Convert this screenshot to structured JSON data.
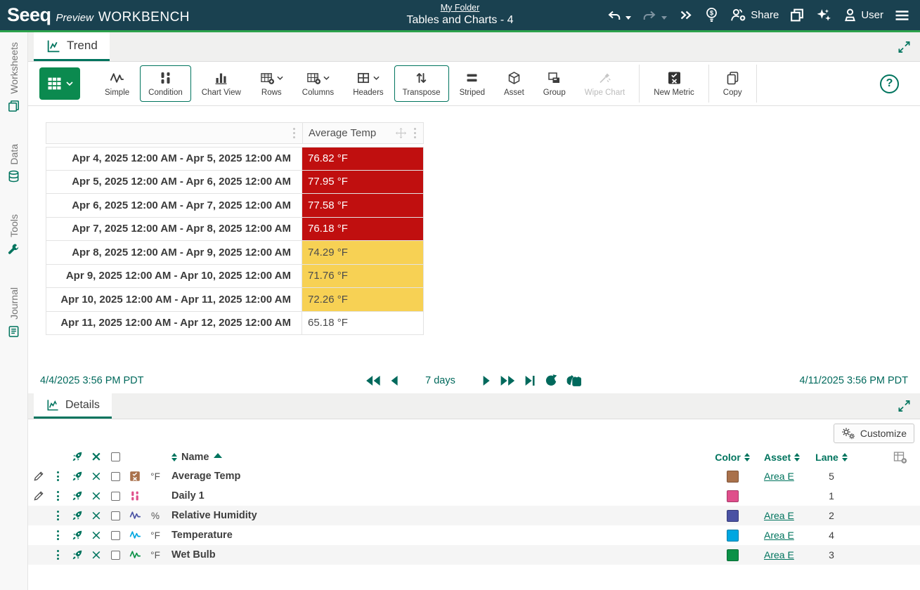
{
  "theme": {
    "accent": "#00745e",
    "topbar_bg": "#1a4150",
    "topbar_green": "#2ca24c",
    "view_button_green": "#0b8a4f",
    "alert_red": "#c00f0f",
    "warn_yellow": "#f7d154"
  },
  "topbar": {
    "brand": "Seeq",
    "preview": "Preview",
    "product": "WORKBENCH",
    "breadcrumb": "My Folder",
    "title": "Tables and Charts - 4",
    "share": "Share",
    "user": "User"
  },
  "sidebar": {
    "items": [
      {
        "label": "Worksheets"
      },
      {
        "label": "Data"
      },
      {
        "label": "Tools"
      },
      {
        "label": "Journal"
      }
    ]
  },
  "trend": {
    "tab": "Trend",
    "toolbar": {
      "simple": "Simple",
      "condition": "Condition",
      "chart_view": "Chart View",
      "rows": "Rows",
      "columns": "Columns",
      "headers": "Headers",
      "transpose": "Transpose",
      "striped": "Striped",
      "asset": "Asset",
      "group": "Group",
      "wipe_chart": "Wipe Chart",
      "new_metric": "New Metric",
      "copy": "Copy"
    },
    "table": {
      "value_column": "Average Temp",
      "rows": [
        {
          "range": "Apr 4, 2025 12:00 AM - Apr 5, 2025 12:00 AM",
          "value": "76.82 °F",
          "bg": "#c00f0f",
          "fg": "#ffffff"
        },
        {
          "range": "Apr 5, 2025 12:00 AM - Apr 6, 2025 12:00 AM",
          "value": "77.95 °F",
          "bg": "#c00f0f",
          "fg": "#ffffff"
        },
        {
          "range": "Apr 6, 2025 12:00 AM - Apr 7, 2025 12:00 AM",
          "value": "77.58 °F",
          "bg": "#c00f0f",
          "fg": "#ffffff"
        },
        {
          "range": "Apr 7, 2025 12:00 AM - Apr 8, 2025 12:00 AM",
          "value": "76.18 °F",
          "bg": "#c00f0f",
          "fg": "#ffffff"
        },
        {
          "range": "Apr 8, 2025 12:00 AM - Apr 9, 2025 12:00 AM",
          "value": "74.29 °F",
          "bg": "#f7d154",
          "fg": "#4b4b4b"
        },
        {
          "range": "Apr 9, 2025 12:00 AM - Apr 10, 2025 12:00 AM",
          "value": "71.76 °F",
          "bg": "#f7d154",
          "fg": "#4b4b4b"
        },
        {
          "range": "Apr 10, 2025 12:00 AM - Apr 11, 2025 12:00 AM",
          "value": "72.26 °F",
          "bg": "#f7d154",
          "fg": "#4b4b4b"
        },
        {
          "range": "Apr 11, 2025 12:00 AM - Apr 12, 2025 12:00 AM",
          "value": "65.18 °F",
          "bg": "#ffffff",
          "fg": "#4b4b4b"
        }
      ]
    },
    "timebar": {
      "start": "4/4/2025 3:56 PM  PDT",
      "duration": "7 days",
      "end": "4/11/2025 3:56 PM  PDT"
    }
  },
  "details": {
    "tab": "Details",
    "customize": "Customize",
    "columns": {
      "name": "Name",
      "color": "Color",
      "asset": "Asset",
      "lane": "Lane"
    },
    "rows": [
      {
        "type": "metric",
        "unit": "°F",
        "name": "Average Temp",
        "color": "#a9714b",
        "asset": "Area E",
        "lane": "5"
      },
      {
        "type": "condition",
        "unit": "",
        "name": "Daily 1",
        "color": "#df4e8b",
        "asset": "",
        "lane": "1"
      },
      {
        "type": "signal",
        "unit": "%",
        "name": "Relative Humidity",
        "color": "#4a52a3",
        "asset": "Area E",
        "lane": "2"
      },
      {
        "type": "signal",
        "unit": "°F",
        "name": "Temperature",
        "color": "#00a7e1",
        "asset": "Area E",
        "lane": "4"
      },
      {
        "type": "signal",
        "unit": "°F",
        "name": "Wet Bulb",
        "color": "#0b9147",
        "asset": "Area E",
        "lane": "3"
      }
    ]
  }
}
